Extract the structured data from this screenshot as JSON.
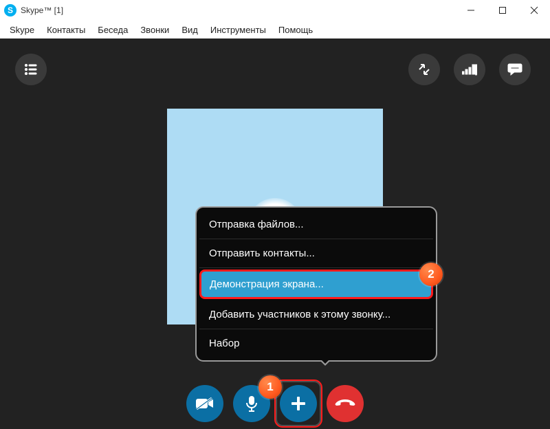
{
  "window": {
    "title": "Skype™ [1]"
  },
  "menu": {
    "items": [
      "Skype",
      "Контакты",
      "Беседа",
      "Звонки",
      "Вид",
      "Инструменты",
      "Помощь"
    ]
  },
  "popup": {
    "items": [
      {
        "label": "Отправка файлов..."
      },
      {
        "label": "Отправить контакты..."
      },
      {
        "label": "Демонстрация экрана...",
        "highlighted": true
      },
      {
        "label": "Добавить участников к этому звонку..."
      },
      {
        "label": "Набор"
      }
    ]
  },
  "annotations": {
    "one": "1",
    "two": "2"
  },
  "controls": {
    "video": "video-off",
    "mic": "mic",
    "plus": "add",
    "hangup": "hangup"
  },
  "colors": {
    "accent_blue": "#0b6fa4",
    "hangup_red": "#e03131",
    "skype_blue": "#00aff0",
    "avatar_bg": "#aedcf4",
    "callout_orange": "#ff5a1f",
    "highlight_red": "#ff1a1a"
  }
}
